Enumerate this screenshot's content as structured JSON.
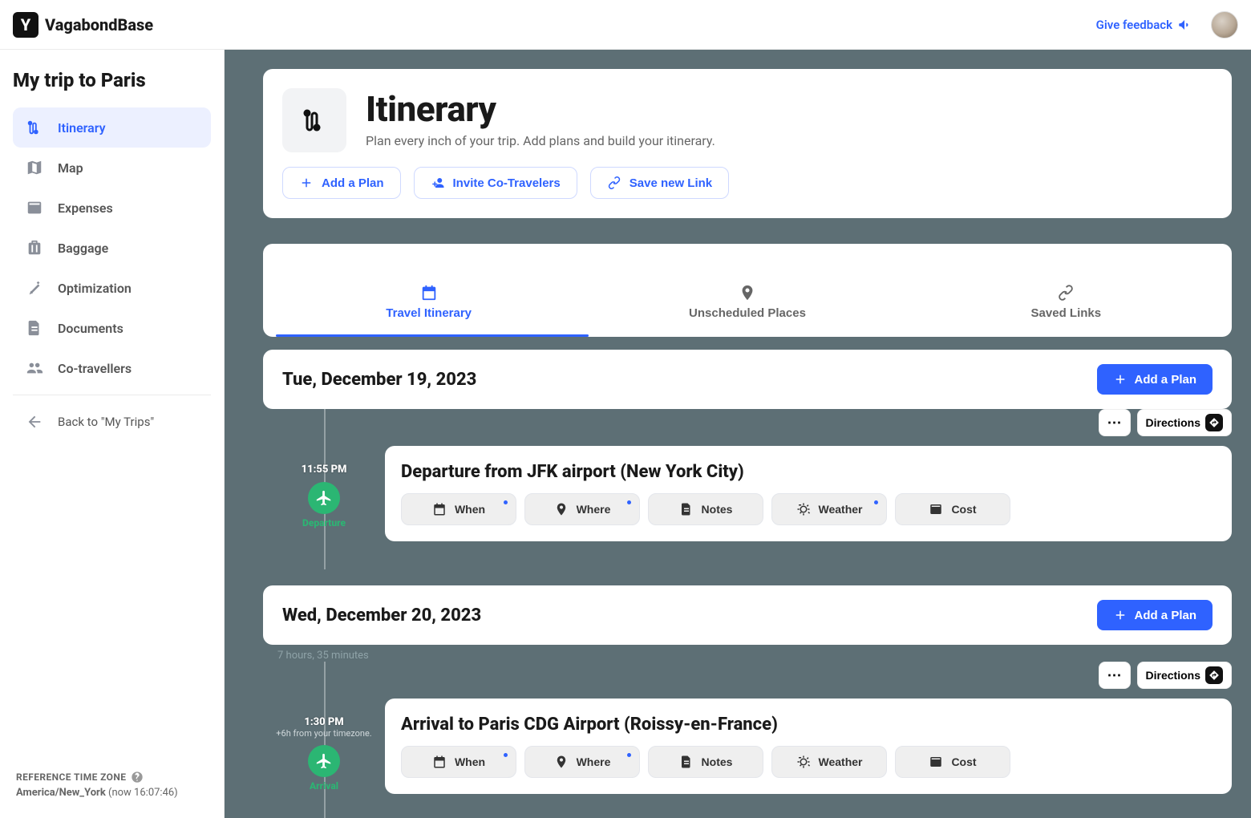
{
  "app": {
    "name": "VagabondBase",
    "feedback_label": "Give feedback"
  },
  "sidebar": {
    "trip_title": "My trip to Paris",
    "items": [
      {
        "label": "Itinerary"
      },
      {
        "label": "Map"
      },
      {
        "label": "Expenses"
      },
      {
        "label": "Baggage"
      },
      {
        "label": "Optimization"
      },
      {
        "label": "Documents"
      },
      {
        "label": "Co-travellers"
      }
    ],
    "back_label": "Back to \"My Trips\"",
    "tz_header": "REFERENCE TIME ZONE",
    "tz_zone": "America/New_York",
    "tz_now": "(now 16:07:46)"
  },
  "header": {
    "title": "Itinerary",
    "subtitle": "Plan every inch of your trip. Add plans and build your itinerary.",
    "actions": {
      "add_plan": "Add a Plan",
      "invite": "Invite Co-Travelers",
      "save_link": "Save new Link"
    }
  },
  "tabs": {
    "itinerary": "Travel Itinerary",
    "unscheduled": "Unscheduled Places",
    "saved_links": "Saved Links"
  },
  "days": [
    {
      "date_label": "Tue, December 19, 2023",
      "add_label": "Add a Plan"
    },
    {
      "date_label": "Wed, December 20, 2023",
      "add_label": "Add a Plan"
    }
  ],
  "events": [
    {
      "time": "11:55 PM",
      "tz_offset": "",
      "kind": "Departure",
      "title": "Departure from JFK airport (New York City)"
    },
    {
      "time": "1:30 PM",
      "tz_offset": "+6h from your timezone.",
      "kind": "Arrival",
      "title": "Arrival to Paris CDG Airport (Roissy-en-France)"
    }
  ],
  "duration_label": "7 hours, 35 minutes",
  "chips": {
    "when": "When",
    "where": "Where",
    "notes": "Notes",
    "weather": "Weather",
    "cost": "Cost"
  },
  "event_actions": {
    "more": "⋯",
    "directions": "Directions"
  }
}
